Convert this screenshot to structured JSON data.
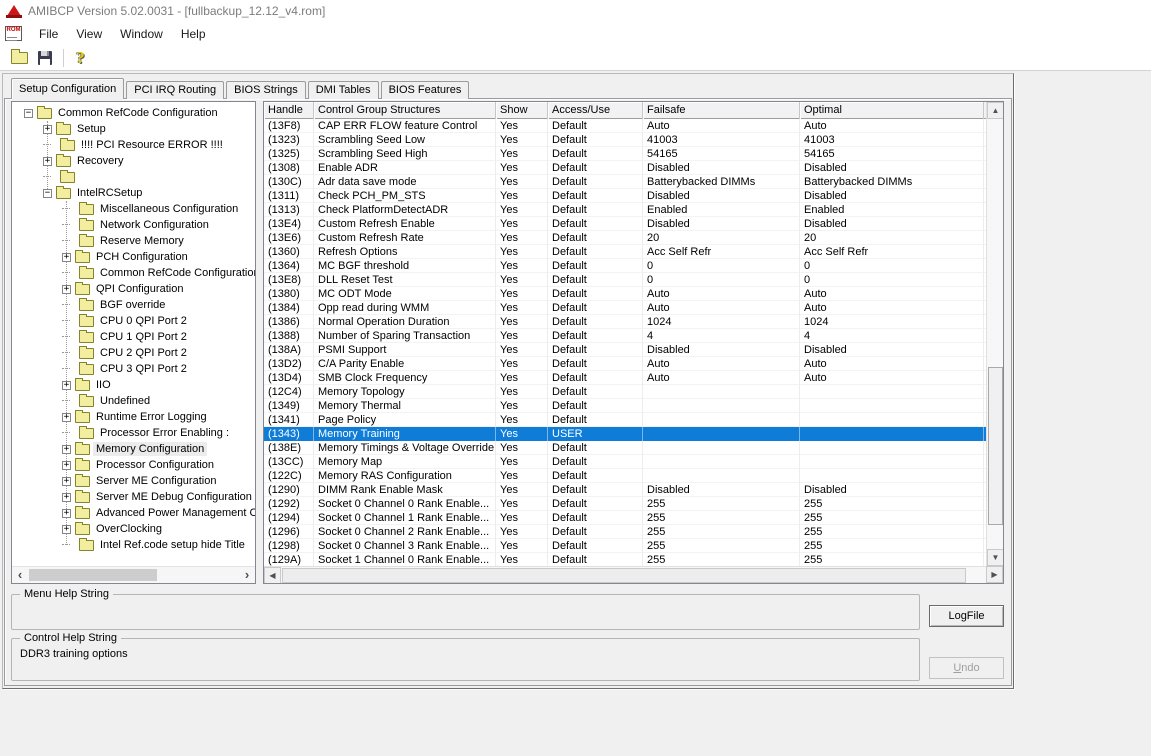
{
  "window": {
    "title": "AMIBCP Version 5.02.0031 - [fullbackup_12.12_v4.rom]"
  },
  "menu": {
    "items": [
      "File",
      "View",
      "Window",
      "Help"
    ]
  },
  "toolbar": {
    "buttons": [
      "open-file",
      "save-file",
      "help"
    ]
  },
  "tabs": {
    "active_index": 0,
    "items": [
      "Setup Configuration",
      "PCI IRQ Routing",
      "BIOS Strings",
      "DMI Tables",
      "BIOS Features"
    ]
  },
  "tree": {
    "items": [
      {
        "label": "Common RefCode Configuration",
        "depth": 0,
        "expand": "minus",
        "selected": false
      },
      {
        "label": "Setup",
        "depth": 1,
        "expand": "plus",
        "selected": false
      },
      {
        "label": "!!!! PCI Resource ERROR !!!!",
        "depth": 1,
        "expand": "none",
        "selected": false
      },
      {
        "label": "Recovery",
        "depth": 1,
        "expand": "plus",
        "selected": false
      },
      {
        "label": "",
        "depth": 1,
        "expand": "none",
        "selected": false
      },
      {
        "label": "IntelRCSetup",
        "depth": 1,
        "expand": "minus",
        "selected": false
      },
      {
        "label": "Miscellaneous Configuration",
        "depth": 2,
        "expand": "none",
        "selected": false
      },
      {
        "label": "Network Configuration",
        "depth": 2,
        "expand": "none",
        "selected": false
      },
      {
        "label": "Reserve Memory",
        "depth": 2,
        "expand": "none",
        "selected": false
      },
      {
        "label": "PCH Configuration",
        "depth": 2,
        "expand": "plus",
        "selected": false
      },
      {
        "label": "Common RefCode Configuration",
        "depth": 2,
        "expand": "none",
        "selected": false
      },
      {
        "label": "QPI Configuration",
        "depth": 2,
        "expand": "plus",
        "selected": false
      },
      {
        "label": "BGF override",
        "depth": 2,
        "expand": "none",
        "selected": false
      },
      {
        "label": "CPU 0 QPI Port 2",
        "depth": 2,
        "expand": "none",
        "selected": false
      },
      {
        "label": "CPU 1 QPI Port 2",
        "depth": 2,
        "expand": "none",
        "selected": false
      },
      {
        "label": "CPU 2 QPI Port 2",
        "depth": 2,
        "expand": "none",
        "selected": false
      },
      {
        "label": "CPU 3 QPI Port 2",
        "depth": 2,
        "expand": "none",
        "selected": false
      },
      {
        "label": "IIO",
        "depth": 2,
        "expand": "plus",
        "selected": false
      },
      {
        "label": "Undefined",
        "depth": 2,
        "expand": "none",
        "selected": false
      },
      {
        "label": "Runtime Error Logging",
        "depth": 2,
        "expand": "plus",
        "selected": false
      },
      {
        "label": "Processor Error Enabling :",
        "depth": 2,
        "expand": "none",
        "selected": false
      },
      {
        "label": "Memory Configuration",
        "depth": 2,
        "expand": "plus",
        "selected": true
      },
      {
        "label": "Processor Configuration",
        "depth": 2,
        "expand": "plus",
        "selected": false
      },
      {
        "label": "Server ME Configuration",
        "depth": 2,
        "expand": "plus",
        "selected": false
      },
      {
        "label": "Server ME Debug Configuration",
        "depth": 2,
        "expand": "plus",
        "selected": false
      },
      {
        "label": "Advanced Power Management C",
        "depth": 2,
        "expand": "plus",
        "selected": false
      },
      {
        "label": "OverClocking",
        "depth": 2,
        "expand": "plus",
        "selected": false
      },
      {
        "label": "Intel Ref.code setup hide Title",
        "depth": 2,
        "expand": "none",
        "selected": false
      }
    ]
  },
  "table": {
    "columns": [
      "Handle",
      "Control Group Structures",
      "Show",
      "Access/Use",
      "Failsafe",
      "Optimal"
    ],
    "selected_row": 22,
    "rows": [
      [
        "(13F8)",
        "CAP ERR FLOW feature Control",
        "Yes",
        "Default",
        "Auto",
        "Auto"
      ],
      [
        "(1323)",
        "Scrambling Seed Low",
        "Yes",
        "Default",
        "41003",
        "41003"
      ],
      [
        "(1325)",
        "Scrambling Seed High",
        "Yes",
        "Default",
        "54165",
        "54165"
      ],
      [
        "(1308)",
        "Enable ADR",
        "Yes",
        "Default",
        "Disabled",
        "Disabled"
      ],
      [
        "(130C)",
        "Adr data save mode",
        "Yes",
        "Default",
        "Batterybacked DIMMs",
        "Batterybacked DIMMs"
      ],
      [
        "(1311)",
        "Check PCH_PM_STS",
        "Yes",
        "Default",
        "Disabled",
        "Disabled"
      ],
      [
        "(1313)",
        "Check PlatformDetectADR",
        "Yes",
        "Default",
        "Enabled",
        "Enabled"
      ],
      [
        "(13E4)",
        "Custom Refresh Enable",
        "Yes",
        "Default",
        "Disabled",
        "Disabled"
      ],
      [
        "(13E6)",
        "Custom Refresh Rate",
        "Yes",
        "Default",
        "20",
        "20"
      ],
      [
        "(1360)",
        "Refresh Options",
        "Yes",
        "Default",
        "Acc Self Refr",
        "Acc Self Refr"
      ],
      [
        "(1364)",
        "MC BGF threshold",
        "Yes",
        "Default",
        "0",
        "0"
      ],
      [
        "(13E8)",
        "DLL Reset Test",
        "Yes",
        "Default",
        "0",
        "0"
      ],
      [
        "(1380)",
        "MC ODT Mode",
        "Yes",
        "Default",
        "Auto",
        "Auto"
      ],
      [
        "(1384)",
        "Opp read during WMM",
        "Yes",
        "Default",
        "Auto",
        "Auto"
      ],
      [
        "(1386)",
        "Normal Operation Duration",
        "Yes",
        "Default",
        "1024",
        "1024"
      ],
      [
        "(1388)",
        "Number of Sparing Transaction",
        "Yes",
        "Default",
        "4",
        "4"
      ],
      [
        "(138A)",
        "PSMI Support",
        "Yes",
        "Default",
        "Disabled",
        "Disabled"
      ],
      [
        "(13D2)",
        "C/A Parity Enable",
        "Yes",
        "Default",
        "Auto",
        "Auto"
      ],
      [
        "(13D4)",
        "SMB Clock Frequency",
        "Yes",
        "Default",
        "Auto",
        "Auto"
      ],
      [
        "(12C4)",
        "Memory Topology",
        "Yes",
        "Default",
        "",
        ""
      ],
      [
        "(1349)",
        "Memory Thermal",
        "Yes",
        "Default",
        "",
        ""
      ],
      [
        "(1341)",
        "Page Policy",
        "Yes",
        "Default",
        "",
        ""
      ],
      [
        "(1343)",
        "Memory Training",
        "Yes",
        "USER",
        "",
        ""
      ],
      [
        "(138E)",
        "Memory Timings & Voltage Override",
        "Yes",
        "Default",
        "",
        ""
      ],
      [
        "(13CC)",
        "Memory Map",
        "Yes",
        "Default",
        "",
        ""
      ],
      [
        "(122C)",
        "Memory RAS Configuration",
        "Yes",
        "Default",
        "",
        ""
      ],
      [
        "(1290)",
        "DIMM Rank Enable Mask",
        "Yes",
        "Default",
        "Disabled",
        "Disabled"
      ],
      [
        "(1292)",
        "Socket 0 Channel 0 Rank Enable...",
        "Yes",
        "Default",
        "255",
        "255"
      ],
      [
        "(1294)",
        "Socket 0 Channel 1 Rank Enable...",
        "Yes",
        "Default",
        "255",
        "255"
      ],
      [
        "(1296)",
        "Socket 0 Channel 2 Rank Enable...",
        "Yes",
        "Default",
        "255",
        "255"
      ],
      [
        "(1298)",
        "Socket 0 Channel 3 Rank Enable...",
        "Yes",
        "Default",
        "255",
        "255"
      ],
      [
        "(129A)",
        "Socket 1 Channel 0 Rank Enable...",
        "Yes",
        "Default",
        "255",
        "255"
      ]
    ]
  },
  "help": {
    "menu_group_label": "Menu Help String",
    "menu_text": "",
    "control_group_label": "Control Help String",
    "control_text": "DDR3 training options"
  },
  "buttons": {
    "logfile": "LogFile",
    "undo": "Undo"
  },
  "icons": {
    "rom_label": "ROM",
    "help_glyph": "?",
    "expand_plus": "+",
    "expand_minus": "−",
    "scroll_up": "▲",
    "scroll_down": "▼",
    "scroll_left_small": "◀",
    "scroll_right_small": "▶",
    "tree_scroll_left": "‹",
    "tree_scroll_right": "›"
  },
  "colors": {
    "selection_blue": "#0f7cd8",
    "folder_yellow": "#f3eda0",
    "window_bg": "#f0f0f0",
    "title_text_gray": "#7c7c7c"
  }
}
